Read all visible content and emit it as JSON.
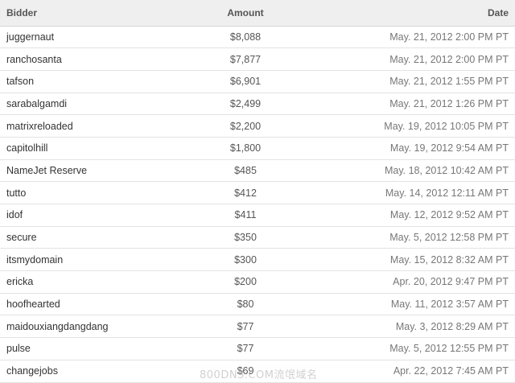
{
  "table": {
    "headers": {
      "bidder": "Bidder",
      "amount": "Amount",
      "date": "Date"
    },
    "rows": [
      {
        "bidder": "juggernaut",
        "amount": "$8,088",
        "date": "May. 21, 2012 2:00 PM PT"
      },
      {
        "bidder": "ranchosanta",
        "amount": "$7,877",
        "date": "May. 21, 2012 2:00 PM PT"
      },
      {
        "bidder": "tafson",
        "amount": "$6,901",
        "date": "May. 21, 2012 1:55 PM PT"
      },
      {
        "bidder": "sarabalgamdi",
        "amount": "$2,499",
        "date": "May. 21, 2012 1:26 PM PT"
      },
      {
        "bidder": "matrixreloaded",
        "amount": "$2,200",
        "date": "May. 19, 2012 10:05 PM PT"
      },
      {
        "bidder": "capitolhill",
        "amount": "$1,800",
        "date": "May. 19, 2012 9:54 AM PT"
      },
      {
        "bidder": "NameJet Reserve",
        "amount": "$485",
        "date": "May. 18, 2012 10:42 AM PT"
      },
      {
        "bidder": "tutto",
        "amount": "$412",
        "date": "May. 14, 2012 12:11 AM PT"
      },
      {
        "bidder": "idof",
        "amount": "$411",
        "date": "May. 12, 2012 9:52 AM PT"
      },
      {
        "bidder": "secure",
        "amount": "$350",
        "date": "May. 5, 2012 12:58 PM PT"
      },
      {
        "bidder": "itsmydomain",
        "amount": "$300",
        "date": "May. 15, 2012 8:32 AM PT"
      },
      {
        "bidder": "ericka",
        "amount": "$200",
        "date": "Apr. 20, 2012 9:47 PM PT"
      },
      {
        "bidder": "hoofhearted",
        "amount": "$80",
        "date": "May. 11, 2012 3:57 AM PT"
      },
      {
        "bidder": "maidouxiangdangdang",
        "amount": "$77",
        "date": "May. 3, 2012 8:29 AM PT"
      },
      {
        "bidder": "pulse",
        "amount": "$77",
        "date": "May. 5, 2012 12:55 PM PT"
      },
      {
        "bidder": "changejobs",
        "amount": "$69",
        "date": "Apr. 22, 2012 7:45 AM PT"
      }
    ]
  },
  "watermark": "800DNS.COM流氓域名",
  "colors": {
    "header_bg": "#efefef",
    "row_border": "#e3e3e3",
    "text": "#333333",
    "date_text": "#777777"
  }
}
